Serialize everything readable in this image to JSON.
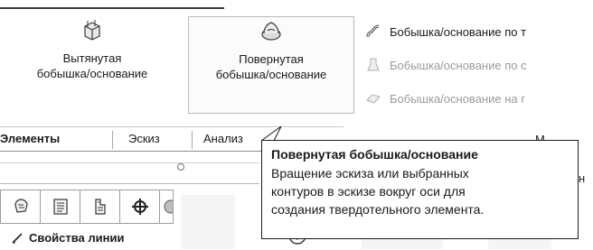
{
  "ribbon": {
    "extrude": {
      "line1": "Вытянутая",
      "line2": "бобышка/основание",
      "icon": "extruded-boss-icon"
    },
    "revolve": {
      "line1": "Повернутая",
      "line2": "бобышка/основание",
      "icon": "revolved-boss-icon"
    },
    "small": [
      {
        "label": "Бобышка/основание по т",
        "icon": "swept-boss-icon",
        "enabled": true
      },
      {
        "label": "Бобышка/основание по с",
        "icon": "lofted-boss-icon",
        "enabled": false
      },
      {
        "label": "Бобышка/основание на г",
        "icon": "boundary-boss-icon",
        "enabled": false
      }
    ]
  },
  "tabs": [
    "Элементы",
    "Эскиз",
    "Анализ"
  ],
  "tab_rest": "М",
  "tooltip": {
    "title": "Повернутая бобышка/основание",
    "body": [
      "Вращение эскиза или выбранных",
      "контуров в эскизе вокруг оси для",
      "создания твердотельного элемента."
    ]
  },
  "panel_tabs": [
    "feature-manager-icon",
    "property-manager-icon",
    "configuration-manager-icon",
    "dimxpert-icon"
  ],
  "property_title": "Свойства линии",
  "right_fragment": "н",
  "colors": {
    "tooltip_border": "#1a1a1a",
    "disabled_text": "#9b9b9b"
  }
}
